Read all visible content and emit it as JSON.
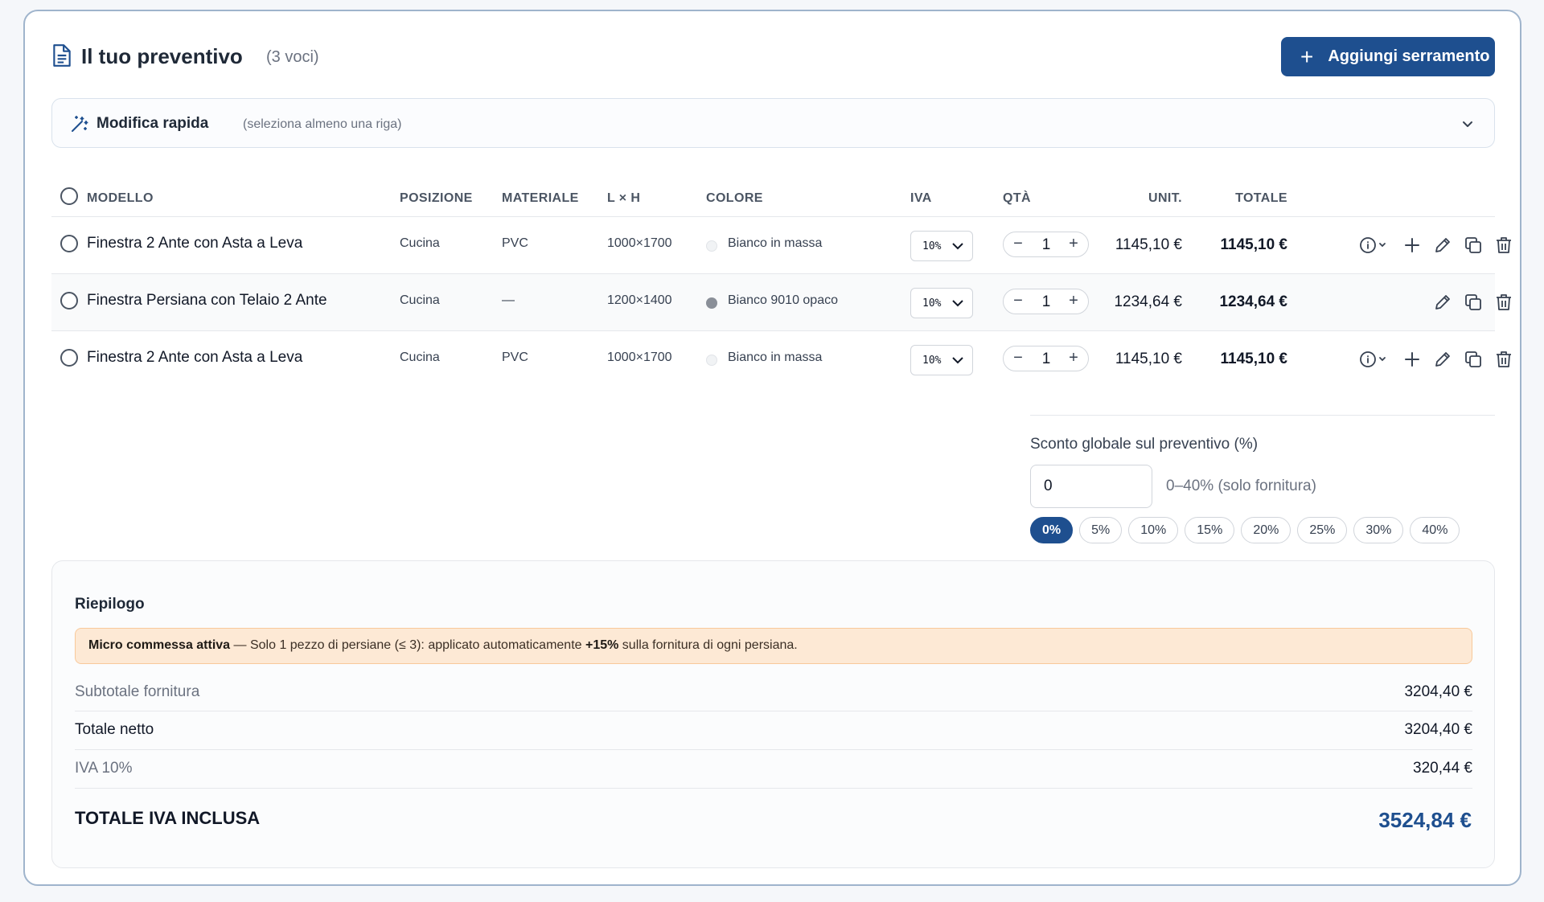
{
  "header": {
    "title": "Il tuo preventivo",
    "count": "(3 voci)",
    "add_label": "Aggiungi serramento"
  },
  "quick_edit": {
    "label": "Modifica rapida",
    "hint": "(seleziona almeno una riga)"
  },
  "table": {
    "headers": {
      "model": "MODELLO",
      "position": "POSIZIONE",
      "material": "MATERIALE",
      "size": "L × H",
      "color": "COLORE",
      "iva": "IVA",
      "qty": "QTÀ",
      "unit": "UNIT.",
      "total": "TOTALE"
    },
    "rows": [
      {
        "model": "Finestra 2 Ante con Asta a Leva",
        "position": "Cucina",
        "material": "PVC",
        "size": "1000×1700",
        "color": "Bianco in massa",
        "color_hex": "#f1f3f5",
        "iva": "10%",
        "qty": "1",
        "unit": "1145,10 €",
        "total": "1145,10 €",
        "has_info": true
      },
      {
        "model": "Finestra Persiana con Telaio 2 Ante",
        "position": "Cucina",
        "material": "—",
        "size": "1200×1400",
        "color": "Bianco 9010 opaco",
        "color_hex": "#8a8f98",
        "iva": "10%",
        "qty": "1",
        "unit": "1234,64 €",
        "total": "1234,64 €",
        "has_info": false
      },
      {
        "model": "Finestra 2 Ante con Asta a Leva",
        "position": "Cucina",
        "material": "PVC",
        "size": "1000×1700",
        "color": "Bianco in massa",
        "color_hex": "#f1f3f5",
        "iva": "10%",
        "qty": "1",
        "unit": "1145,10 €",
        "total": "1145,10 €",
        "has_info": true
      }
    ]
  },
  "discount": {
    "title": "Sconto globale sul preventivo (%)",
    "value": "0",
    "hint": "0–40% (solo fornitura)",
    "chips": [
      "0%",
      "5%",
      "10%",
      "15%",
      "20%",
      "25%",
      "30%",
      "40%"
    ],
    "active": "0%"
  },
  "summary": {
    "title": "Riepilogo",
    "notice_bold": "Micro commessa attiva",
    "notice_text": " — Solo 1 pezzo di persiane (≤ 3): applicato automaticamente ",
    "notice_pct": "+15%",
    "notice_tail": " sulla fornitura di ogni persiana.",
    "subtotal_label": "Subtotale fornitura",
    "subtotal_value": "3204,40 €",
    "net_label": "Totale netto",
    "net_value": "3204,40 €",
    "iva_label": "IVA 10%",
    "iva_value": "320,44 €",
    "grand_label": "TOTALE IVA INCLUSA",
    "grand_value": "3524,84 €"
  },
  "colors": {
    "primary": "#1e4f8f",
    "notice_bg": "#fde9d5"
  }
}
